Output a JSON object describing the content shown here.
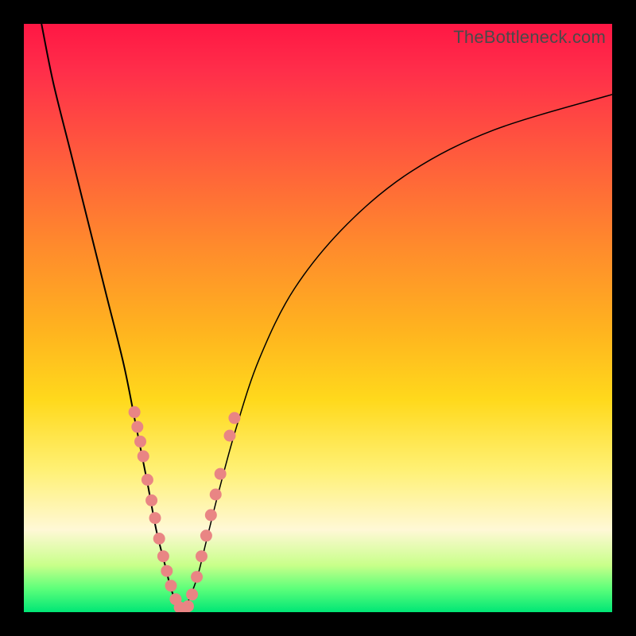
{
  "watermark": "TheBottleneck.com",
  "colors": {
    "frame": "#000000",
    "curve": "#000000",
    "marker": "#e98584",
    "gradient_top": "#ff1744",
    "gradient_bottom": "#00e676"
  },
  "chart_data": {
    "type": "line",
    "title": "",
    "xlabel": "",
    "ylabel": "",
    "xlim": [
      0,
      100
    ],
    "ylim": [
      0,
      100
    ],
    "series": [
      {
        "name": "left-curve",
        "x": [
          3,
          5,
          8,
          11,
          14,
          17,
          19,
          21,
          22.5,
          24,
          25,
          26,
          27
        ],
        "y": [
          100,
          90,
          78,
          66,
          54,
          42,
          32,
          22,
          14,
          8,
          4,
          1.5,
          0
        ]
      },
      {
        "name": "right-curve",
        "x": [
          27,
          28,
          29.5,
          31,
          33,
          36,
          40,
          46,
          55,
          66,
          80,
          100
        ],
        "y": [
          0,
          2,
          6,
          12,
          20,
          31,
          43,
          55,
          66,
          75,
          82,
          88
        ]
      }
    ],
    "markers": {
      "name": "highlight-points",
      "points": [
        {
          "x": 18.8,
          "y": 34
        },
        {
          "x": 19.3,
          "y": 31.5
        },
        {
          "x": 19.8,
          "y": 29
        },
        {
          "x": 20.3,
          "y": 26.5
        },
        {
          "x": 21.0,
          "y": 22.5
        },
        {
          "x": 21.7,
          "y": 19
        },
        {
          "x": 22.3,
          "y": 16
        },
        {
          "x": 23.0,
          "y": 12.5
        },
        {
          "x": 23.7,
          "y": 9.5
        },
        {
          "x": 24.3,
          "y": 7
        },
        {
          "x": 25.0,
          "y": 4.5
        },
        {
          "x": 25.8,
          "y": 2.2
        },
        {
          "x": 26.5,
          "y": 0.8
        },
        {
          "x": 27.2,
          "y": 0.2
        },
        {
          "x": 27.9,
          "y": 1.0
        },
        {
          "x": 28.6,
          "y": 3.0
        },
        {
          "x": 29.4,
          "y": 6.0
        },
        {
          "x": 30.2,
          "y": 9.5
        },
        {
          "x": 31.0,
          "y": 13
        },
        {
          "x": 31.8,
          "y": 16.5
        },
        {
          "x": 32.6,
          "y": 20
        },
        {
          "x": 33.4,
          "y": 23.5
        },
        {
          "x": 35.0,
          "y": 30
        },
        {
          "x": 35.8,
          "y": 33
        }
      ]
    }
  }
}
